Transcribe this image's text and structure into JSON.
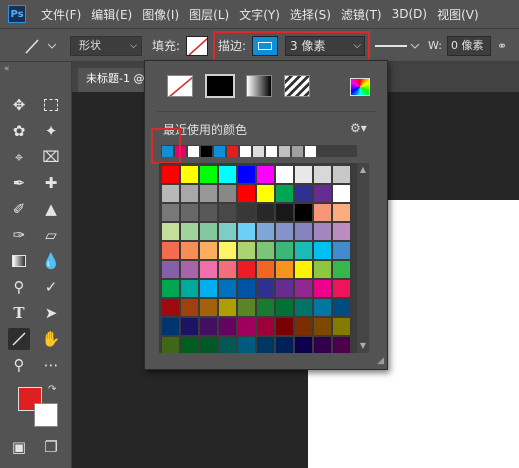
{
  "app": {
    "logo_text": "Ps"
  },
  "menu": [
    "文件(F)",
    "编辑(E)",
    "图像(I)",
    "图层(L)",
    "文字(Y)",
    "选择(S)",
    "滤镜(T)",
    "3D(D)",
    "视图(V)"
  ],
  "options": {
    "shape_mode": "形状",
    "fill_label": "填充:",
    "stroke_label": "描边:",
    "stroke_width": "3 像素",
    "w_label": "W:",
    "w_value": "0 像素",
    "stroke_color": "#0f8fd8",
    "highlight_color": "#e02828"
  },
  "document": {
    "tab_title": "未标题-1 @"
  },
  "tools": [
    "move-icon",
    "marquee-icon",
    "lasso-icon",
    "magic-wand-icon",
    "crop-icon",
    "frame-icon",
    "eyedropper-icon",
    "healing-brush-icon",
    "brush-icon",
    "clone-stamp-icon",
    "history-brush-icon",
    "eraser-icon",
    "gradient-icon",
    "blur-icon",
    "dodge-icon",
    "pen-icon",
    "type-icon",
    "path-select-icon",
    "line-icon",
    "hand-icon",
    "zoom-icon",
    "more-icon",
    "quick-mask-icon",
    "screen-mode-icon"
  ],
  "colors": {
    "foreground": "#e02020",
    "background": "#ffffff"
  },
  "stroke_popup": {
    "recent_label": "最近使用的颜色",
    "recent_colors": [
      "#0f8fd8",
      "#e0007a",
      "#ffffff",
      "#000000",
      "#0f8fd8",
      "#e02020",
      "#ffffff",
      "#dcdcdc",
      "#ffffff",
      "#c0c0c0",
      "#a0a0a0",
      "#ffffff"
    ],
    "swatch_rows": [
      [
        "#ff0000",
        "#ffff00",
        "#00ff00",
        "#00ffff",
        "#0000ff",
        "#ff00ff",
        "#ffffff",
        "#e8e8e8",
        "#d8d8d8",
        "#c8c8c8"
      ],
      [
        "#b8b8b8",
        "#a8a8a8",
        "#989898",
        "#888888",
        "#ff0000",
        "#ffff00",
        "#00a651",
        "#2e3192",
        "#662d91",
        "#ffffff"
      ],
      [
        "#787878",
        "#686868",
        "#585858",
        "#484848",
        "#383838",
        "#282828",
        "#181818",
        "#000000",
        "#f7977a",
        "#f9ad81"
      ],
      [
        "#c4df9b",
        "#a3d39c",
        "#82ca9d",
        "#7bcdc8",
        "#6ecff6",
        "#7ea7d8",
        "#8493ca",
        "#8882be",
        "#a187be",
        "#bc8cbf"
      ],
      [
        "#f26c4f",
        "#f68e55",
        "#fbaf5c",
        "#fff467",
        "#acd372",
        "#7cc576",
        "#3bb878",
        "#1abbb4",
        "#00bff3",
        "#438ccb"
      ],
      [
        "#8560a8",
        "#a864a8",
        "#f06ea9",
        "#f26d7d",
        "#ed1c24",
        "#f26522",
        "#f7941d",
        "#fff200",
        "#8dc63f",
        "#39b54a"
      ],
      [
        "#00a651",
        "#00a99d",
        "#00aeef",
        "#0072bc",
        "#0054a6",
        "#2e3192",
        "#662d91",
        "#92278f",
        "#ec008c",
        "#ed145b"
      ],
      [
        "#9e0b0f",
        "#a0410d",
        "#a3620a",
        "#aba000",
        "#598527",
        "#1a7b30",
        "#007236",
        "#00746b",
        "#0076a3",
        "#004b80"
      ],
      [
        "#003471",
        "#1b1464",
        "#440e62",
        "#630460",
        "#9e005d",
        "#9e0039",
        "#790000",
        "#7b2e00",
        "#7d4900",
        "#827b00"
      ],
      [
        "#406618",
        "#005e20",
        "#005826",
        "#005952",
        "#005b7f",
        "#003663",
        "#002157",
        "#0d004c",
        "#32004b",
        "#4b0049"
      ],
      [
        "#7b0046",
        "#7a0026",
        "#c7b299",
        "#998675",
        "#736357",
        "#534741",
        "#37302d",
        "#c69c6d",
        "#a67c52",
        "#8c6239"
      ]
    ]
  }
}
